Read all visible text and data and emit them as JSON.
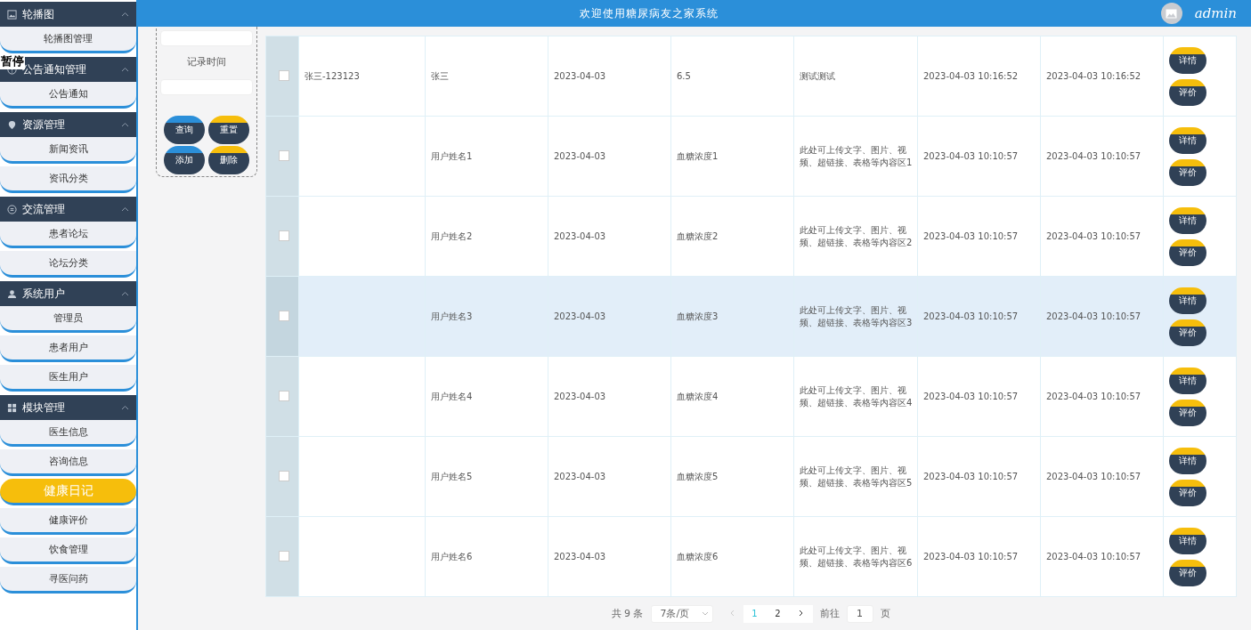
{
  "header": {
    "title": "欢迎使用糖尿病友之家系统",
    "user": "admin"
  },
  "overlay_text": "暂停",
  "sidebar": {
    "groups": [
      {
        "title": "轮播图",
        "expanded": true,
        "items": [
          {
            "label": "轮播图管理",
            "selected": false
          }
        ]
      },
      {
        "title": "公告通知管理",
        "expanded": true,
        "items": [
          {
            "label": "公告通知",
            "selected": false
          }
        ]
      },
      {
        "title": "资源管理",
        "expanded": true,
        "items": [
          {
            "label": "新闻资讯",
            "selected": false
          },
          {
            "label": "资讯分类",
            "selected": false
          }
        ]
      },
      {
        "title": "交流管理",
        "expanded": true,
        "items": [
          {
            "label": "患者论坛",
            "selected": false
          },
          {
            "label": "论坛分类",
            "selected": false
          }
        ]
      },
      {
        "title": "系统用户",
        "expanded": true,
        "items": [
          {
            "label": "管理员",
            "selected": false
          },
          {
            "label": "患者用户",
            "selected": false
          },
          {
            "label": "医生用户",
            "selected": false
          }
        ]
      },
      {
        "title": "模块管理",
        "expanded": true,
        "items": [
          {
            "label": "医生信息",
            "selected": false
          },
          {
            "label": "咨询信息",
            "selected": false
          },
          {
            "label": "健康日记",
            "selected": true
          },
          {
            "label": "健康评价",
            "selected": false
          },
          {
            "label": "饮食管理",
            "selected": false
          },
          {
            "label": "寻医问药",
            "selected": false
          }
        ]
      }
    ]
  },
  "search": {
    "label": "记录时间",
    "buttons": [
      {
        "label": "查询",
        "kind": "blue"
      },
      {
        "label": "重置",
        "kind": "yellow"
      },
      {
        "label": "添加",
        "kind": "blue"
      },
      {
        "label": "删除",
        "kind": "yellow"
      }
    ]
  },
  "table": {
    "rows": [
      {
        "checked": false,
        "hovered": false,
        "cells": [
          "张三-123123",
          "张三",
          "2023-04-03",
          "6.5",
          "测试测试",
          "2023-04-03 10:16:52",
          "2023-04-03 10:16:52"
        ],
        "actions": [
          "详情",
          "评价"
        ]
      },
      {
        "checked": false,
        "hovered": false,
        "cells": [
          "",
          "用户姓名1",
          "2023-04-03",
          "血糖浓度1",
          "此处可上传文字、图片、视频、超链接、表格等内容区1",
          "2023-04-03 10:10:57",
          "2023-04-03 10:10:57"
        ],
        "actions": [
          "详情",
          "评价"
        ]
      },
      {
        "checked": false,
        "hovered": false,
        "cells": [
          "",
          "用户姓名2",
          "2023-04-03",
          "血糖浓度2",
          "此处可上传文字、图片、视频、超链接、表格等内容区2",
          "2023-04-03 10:10:57",
          "2023-04-03 10:10:57"
        ],
        "actions": [
          "详情",
          "评价"
        ]
      },
      {
        "checked": false,
        "hovered": true,
        "cells": [
          "",
          "用户姓名3",
          "2023-04-03",
          "血糖浓度3",
          "此处可上传文字、图片、视频、超链接、表格等内容区3",
          "2023-04-03 10:10:57",
          "2023-04-03 10:10:57"
        ],
        "actions": [
          "详情",
          "评价"
        ]
      },
      {
        "checked": false,
        "hovered": false,
        "cells": [
          "",
          "用户姓名4",
          "2023-04-03",
          "血糖浓度4",
          "此处可上传文字、图片、视频、超链接、表格等内容区4",
          "2023-04-03 10:10:57",
          "2023-04-03 10:10:57"
        ],
        "actions": [
          "详情",
          "评价"
        ]
      },
      {
        "checked": false,
        "hovered": false,
        "cells": [
          "",
          "用户姓名5",
          "2023-04-03",
          "血糖浓度5",
          "此处可上传文字、图片、视频、超链接、表格等内容区5",
          "2023-04-03 10:10:57",
          "2023-04-03 10:10:57"
        ],
        "actions": [
          "详情",
          "评价"
        ]
      },
      {
        "checked": false,
        "hovered": false,
        "cells": [
          "",
          "用户姓名6",
          "2023-04-03",
          "血糖浓度6",
          "此处可上传文字、图片、视频、超链接、表格等内容区6",
          "2023-04-03 10:10:57",
          "2023-04-03 10:10:57"
        ],
        "actions": [
          "详情",
          "评价"
        ]
      }
    ]
  },
  "pagination": {
    "total": "共 9 条",
    "page_size": "7条/页",
    "pages": [
      {
        "label": "1",
        "selected": true
      },
      {
        "label": "2",
        "selected": false
      }
    ],
    "goto_label": "前往",
    "goto_value": "1",
    "page_suffix": "页"
  }
}
